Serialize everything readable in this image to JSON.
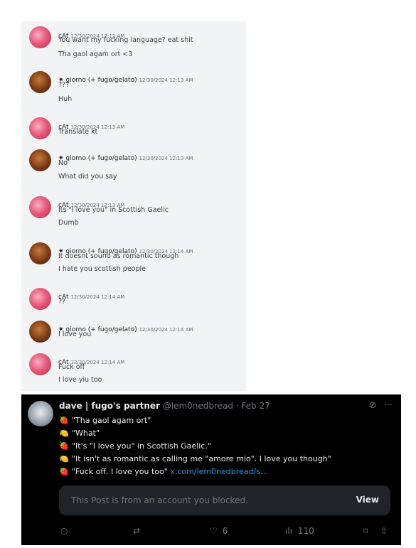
{
  "messages": [
    {
      "author": "cAt",
      "time": "12/30/2024 12:12 AM",
      "lines": [
        "You want my fucking language? eat shit",
        "Tha gaol agam ort <3"
      ]
    },
    {
      "author": "✷ giorno (+ fugo/gelato)",
      "time": "12/30/2024 12:13 AM",
      "lines": [
        "???",
        "Huh"
      ]
    },
    {
      "author": "cAt",
      "time": "12/30/2024 12:13 AM",
      "lines": [
        "Translate kt"
      ]
    },
    {
      "author": "✷ giorno (+ fugo/gelato)",
      "time": "12/30/2024 12:13 AM",
      "lines": [
        "No",
        "What did you say"
      ]
    },
    {
      "author": "cAt",
      "time": "12/30/2024 12:13 AM",
      "lines": [
        "Its \"I love you\" in Scottish Gaelic",
        "Dumb"
      ]
    },
    {
      "author": "✷ giorno (+ fugo/gelato)",
      "time": "12/30/2024 12:14 AM",
      "lines": [
        "It doesnt sound as romantic though",
        "I hate you scottish people"
      ]
    },
    {
      "author": "cAt",
      "time": "12/30/2024 12:14 AM",
      "lines": [
        "??"
      ]
    },
    {
      "author": "✷ giorno (+ fugo/gelato)",
      "time": "12/30/2024 12:14 AM",
      "lines": [
        "I love you"
      ]
    },
    {
      "author": "cAt",
      "time": "12/30/2024 12:14 AM",
      "lines": [
        "Fuck off",
        "I love yiu too"
      ]
    }
  ],
  "tweet": {
    "display_name": "dave | fugo's partner",
    "handle": "@lem0nedbread",
    "sep": "·",
    "date": "Feb 27",
    "grok_icon": "⊘",
    "more_icon": "···",
    "lines": [
      {
        "emoji": "🍓",
        "text": "\"Tha gaol agam ort\""
      },
      {
        "emoji": "🍋",
        "text": "\"What\""
      },
      {
        "emoji": "🍓",
        "text": "\"It's \"I love you\" in Scottish Gaelic.\""
      },
      {
        "emoji": "🍋",
        "text": "\"It isn't as romantic as calling me \"amore mio\". I love you though\""
      },
      {
        "emoji": "🍓",
        "text": "\"Fuck off. I love you too\" ",
        "link": "x.com/lem0nedbread/s…"
      }
    ],
    "blocked_text": "This Post is from an account you blocked.",
    "view_label": "View",
    "likes": "6",
    "views": "110",
    "icons": {
      "reply": "○",
      "repost": "⇄",
      "like": "♡",
      "views": "ılı",
      "bookmark": "⌑",
      "share": "⇧"
    }
  }
}
